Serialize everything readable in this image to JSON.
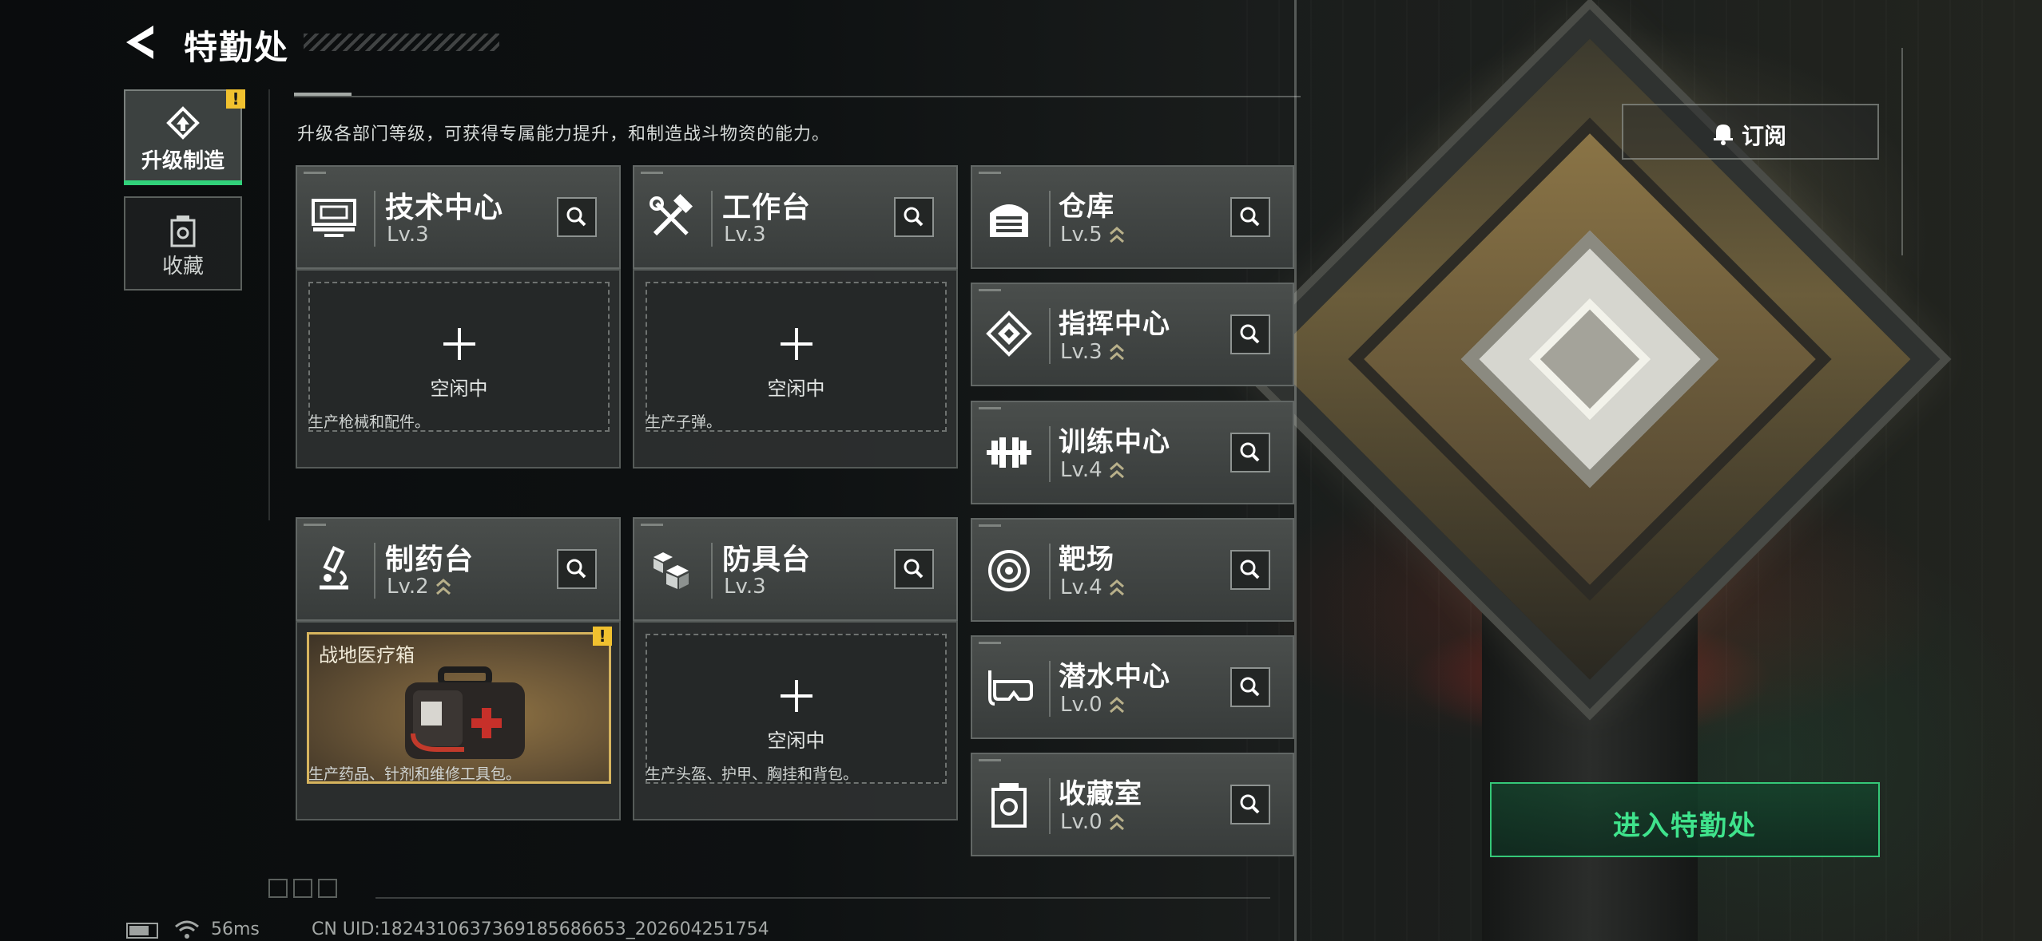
{
  "header": {
    "title": "特勤处"
  },
  "sidebar": {
    "tabs": [
      {
        "label": "升级制造",
        "icon": "upgrade-icon",
        "alert": "!"
      },
      {
        "label": "收藏",
        "icon": "collection-icon"
      }
    ]
  },
  "description": "升级各部门等级，可获得专属能力提升，和制造战斗物资的能力。",
  "subscribe": {
    "label": "订阅",
    "icon": "bell-icon"
  },
  "stations": [
    {
      "name": "技术中心",
      "level": "Lv.3",
      "icon": "tech-center-icon",
      "slot_status": "空闲中",
      "description": "生产枪械和配件。"
    },
    {
      "name": "工作台",
      "level": "Lv.3",
      "icon": "workbench-icon",
      "slot_status": "空闲中",
      "description": "生产子弹。"
    },
    {
      "name": "制药台",
      "level": "Lv.2",
      "icon": "pharmacy-icon",
      "slot_item": "战地医疗箱",
      "slot_alert": "!",
      "description": "生产药品、针剂和维修工具包。"
    },
    {
      "name": "防具台",
      "level": "Lv.3",
      "icon": "armor-bench-icon",
      "slot_status": "空闲中",
      "description": "生产头盔、护甲、胸挂和背包。"
    }
  ],
  "facilities": [
    {
      "name": "仓库",
      "level": "Lv.5",
      "icon": "warehouse-icon"
    },
    {
      "name": "指挥中心",
      "level": "Lv.3",
      "icon": "command-center-icon"
    },
    {
      "name": "训练中心",
      "level": "Lv.4",
      "icon": "training-center-icon"
    },
    {
      "name": "靶场",
      "level": "Lv.4",
      "icon": "shooting-range-icon"
    },
    {
      "name": "潜水中心",
      "level": "Lv.0",
      "icon": "diving-center-icon"
    },
    {
      "name": "收藏室",
      "level": "Lv.0",
      "icon": "collection-room-icon"
    }
  ],
  "enter_button": "进入特勤处",
  "status_bar": {
    "ping": "56ms",
    "uid": "CN UID:1824310637369185686653_202604251754"
  },
  "colors": {
    "accent_green": "#31d17a",
    "alert_yellow": "#f1c12f",
    "panel": "#3c4140"
  }
}
